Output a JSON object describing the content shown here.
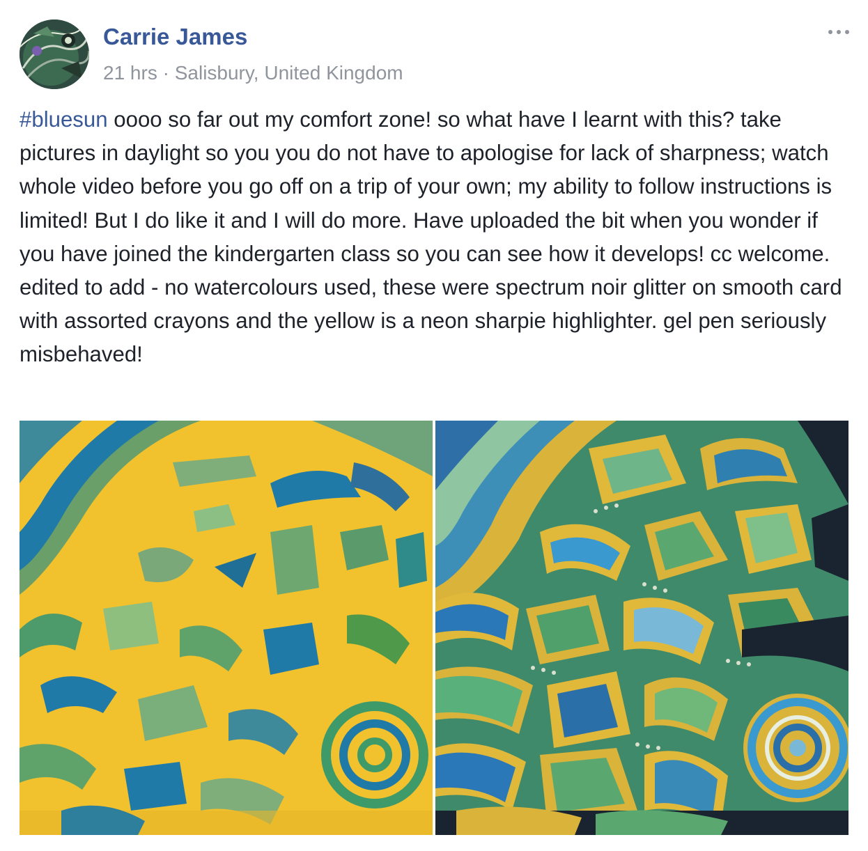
{
  "post": {
    "author": "Carrie James",
    "time": "21 hrs",
    "separator": "·",
    "location": "Salisbury, United Kingdom",
    "hashtag": "#bluesun",
    "body_part1": " oooo so far out my comfort zone! so what have I learnt with this? take pictures in daylight so you you do not have to apologise for lack of sharpness; watch whole video before you go off on a trip of your own; my ability to follow instructions is limited! But I do like it and I will do more. Have uploaded the bit when you wonder if you have joined the kindergarten class so you can see how it develops! cc welcome.",
    "body_part2": "edited to add - no watercolours used, these were spectrum noir glitter on smooth card with assorted crayons and the yellow is a neon sharpie highlighter. gel pen seriously misbehaved!"
  },
  "icons": {
    "more": "more-options-icon"
  },
  "colors": {
    "link": "#385898",
    "meta": "#90949c",
    "text": "#1d2129",
    "art_yellow": "#f2c12e",
    "art_blue": "#1f7aa8",
    "art_green": "#4f9a4a",
    "art_dark": "#1a2430"
  }
}
